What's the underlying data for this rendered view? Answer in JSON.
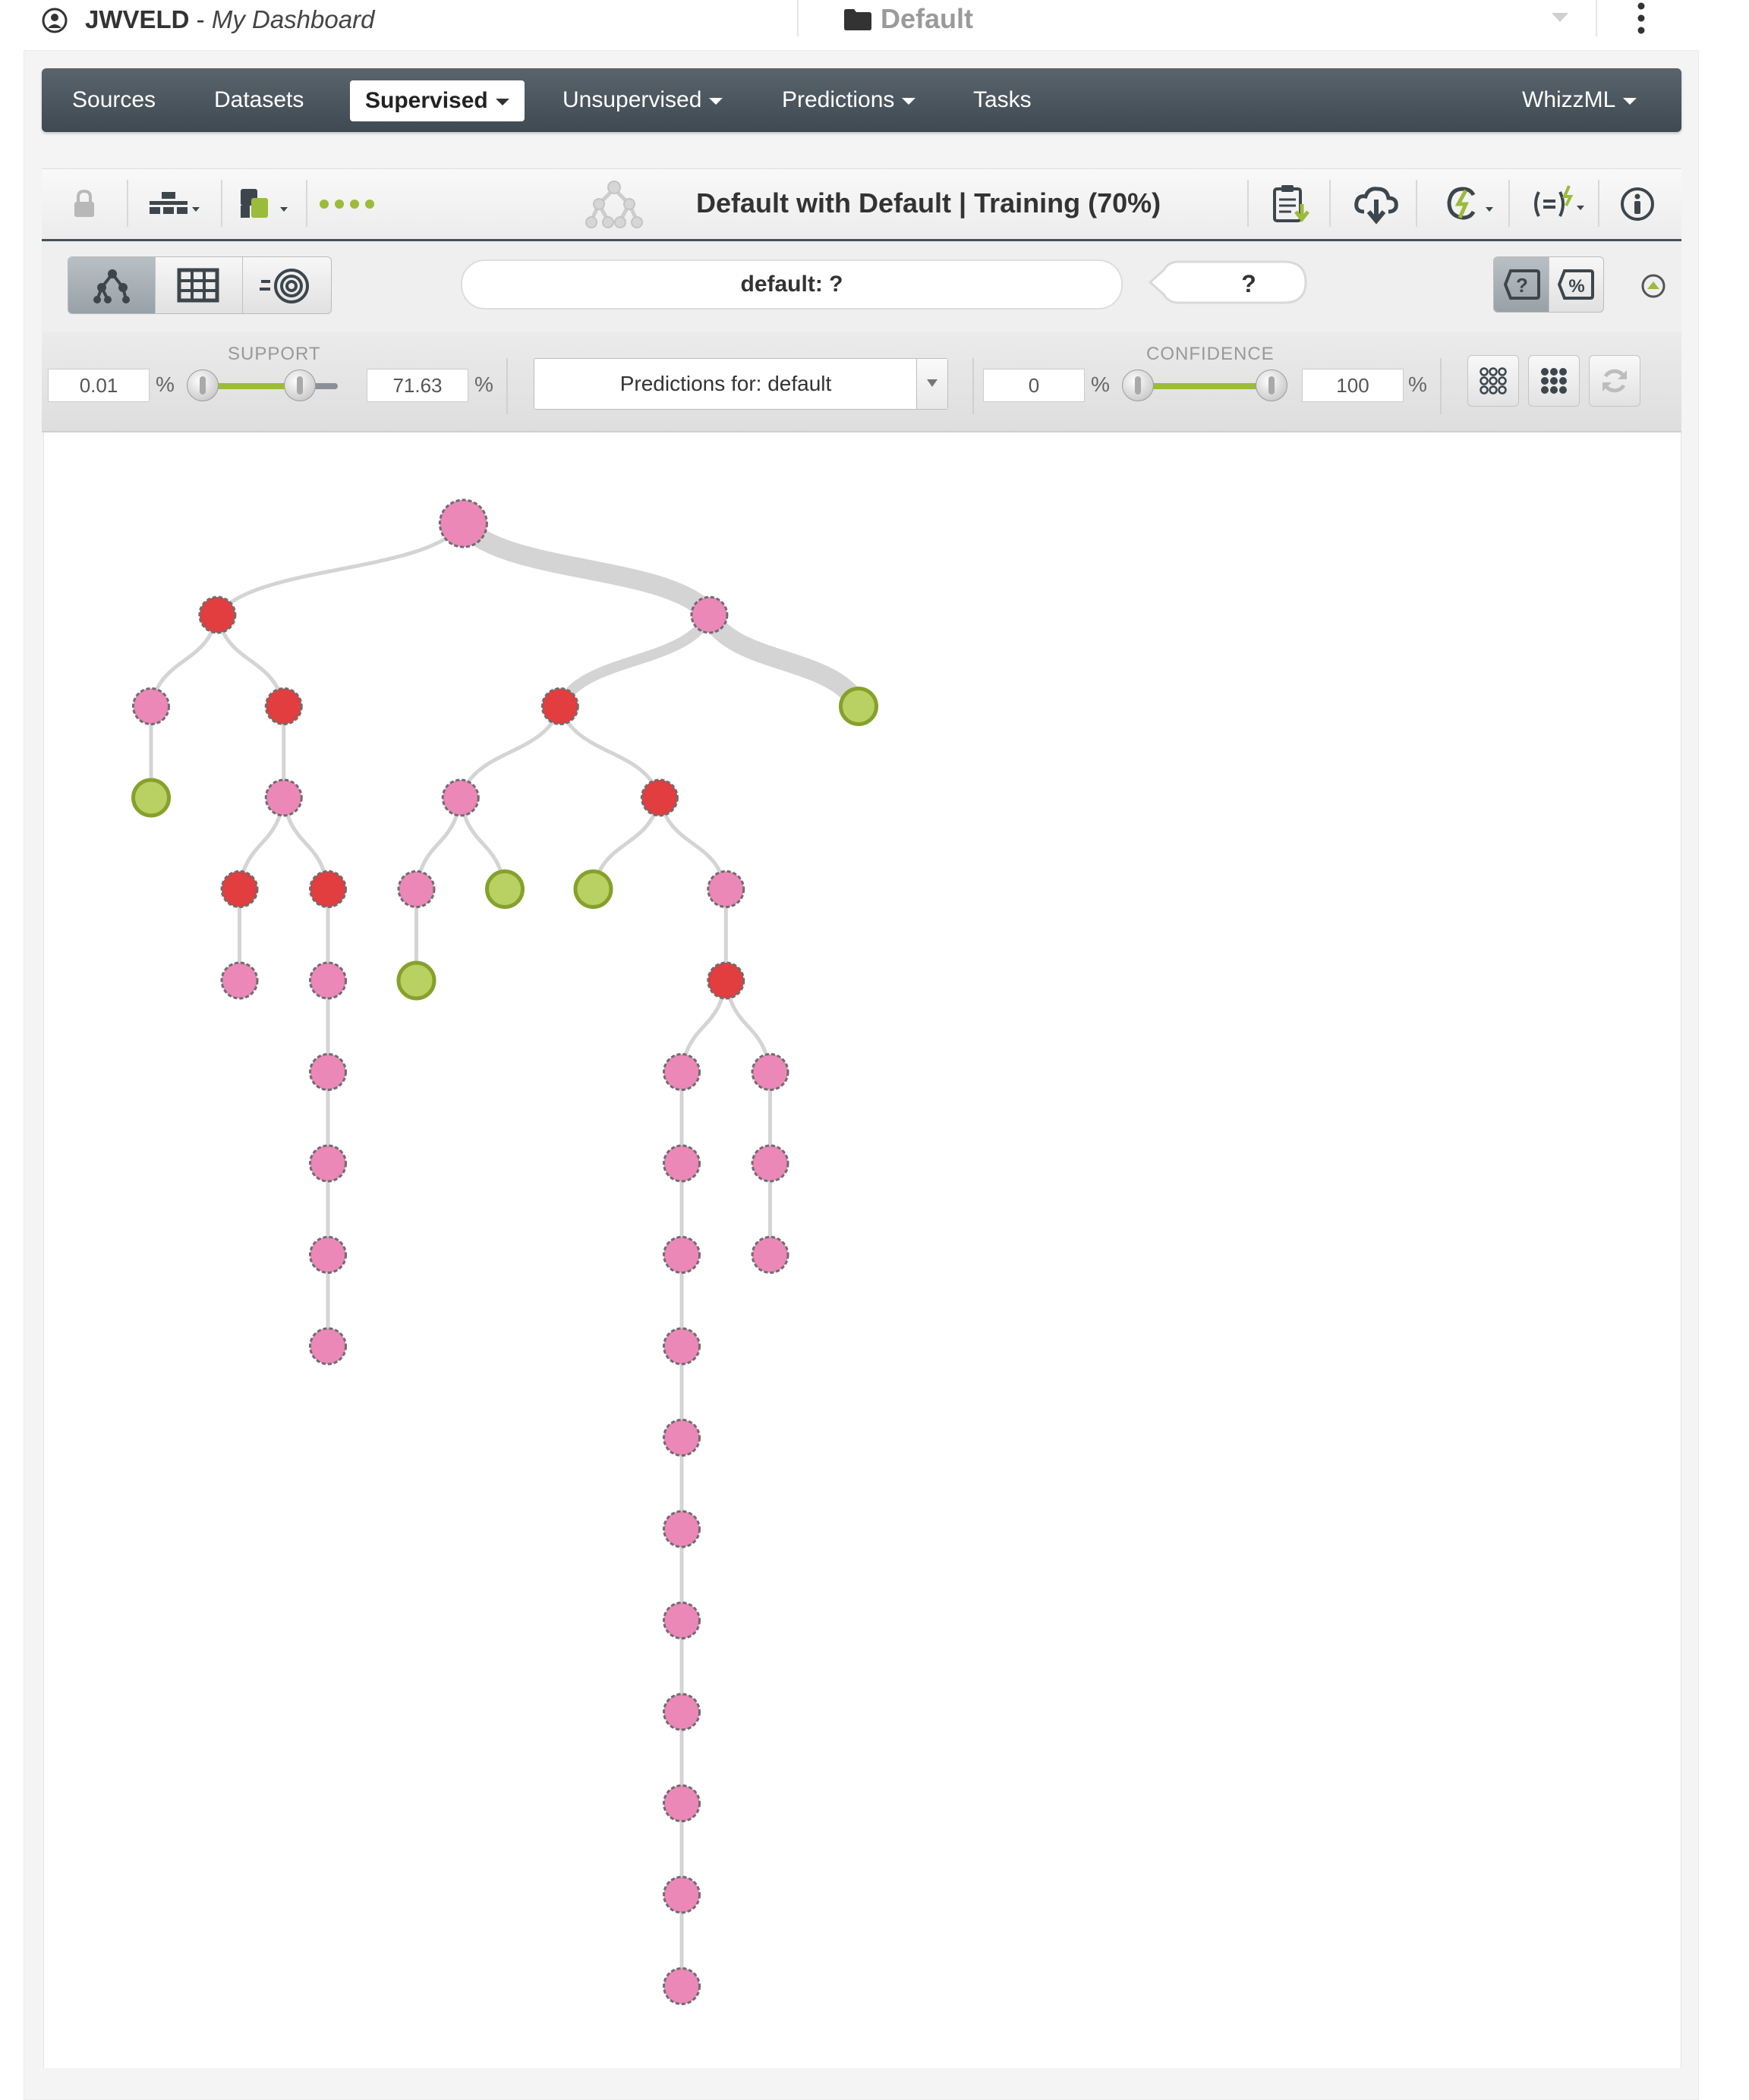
{
  "header": {
    "username": "JWVELD",
    "separator": " - ",
    "dashboard_label": "My Dashboard",
    "project_name": "Default"
  },
  "nav": {
    "items": [
      {
        "label": "Sources",
        "dropdown": false
      },
      {
        "label": "Datasets",
        "dropdown": false
      },
      {
        "label": "Supervised",
        "dropdown": true,
        "active": true
      },
      {
        "label": "Unsupervised",
        "dropdown": true
      },
      {
        "label": "Predictions",
        "dropdown": true
      },
      {
        "label": "Tasks",
        "dropdown": false
      }
    ],
    "right_item": {
      "label": "WhizzML",
      "dropdown": true
    }
  },
  "model": {
    "title": "Default with Default | Training (70%)"
  },
  "prediction": {
    "input_text": "default: ?",
    "result": "?"
  },
  "filters": {
    "support_label": "SUPPORT",
    "support_min": "0.01",
    "support_max": "71.63",
    "support_fill_fraction": [
      0.0,
      0.72
    ],
    "percent_symbol": "%",
    "predictions_for": "Predictions for: default",
    "confidence_label": "CONFIDENCE",
    "confidence_min": "0",
    "confidence_max": "100",
    "confidence_fill_fraction": [
      0.0,
      1.0
    ]
  },
  "tree": {
    "colors": {
      "pink": "#ec88b8",
      "red": "#e23d3f",
      "green": "#b9d062",
      "edge": "#d4d4d4",
      "accent": "#9cbb3a",
      "nav_dark": "#45505a"
    },
    "nodes": [
      {
        "id": "root",
        "parent": null,
        "type": "pink",
        "weight": "heavy"
      },
      {
        "id": "n1",
        "parent": "root",
        "type": "red"
      },
      {
        "id": "n2",
        "parent": "root",
        "type": "pink",
        "weight": "heavy"
      },
      {
        "id": "n3",
        "parent": "n1",
        "type": "pink"
      },
      {
        "id": "n4",
        "parent": "n1",
        "type": "red"
      },
      {
        "id": "n5",
        "parent": "n2",
        "type": "red",
        "weight": "medium"
      },
      {
        "id": "n6",
        "parent": "n2",
        "type": "green",
        "weight": "heavy"
      },
      {
        "id": "n7",
        "parent": "n3",
        "type": "green"
      },
      {
        "id": "n8",
        "parent": "n4",
        "type": "pink"
      },
      {
        "id": "n9",
        "parent": "n5",
        "type": "pink"
      },
      {
        "id": "n10",
        "parent": "n5",
        "type": "red"
      },
      {
        "id": "n11",
        "parent": "n8",
        "type": "red"
      },
      {
        "id": "n12",
        "parent": "n8",
        "type": "red"
      },
      {
        "id": "n13",
        "parent": "n9",
        "type": "pink"
      },
      {
        "id": "n14",
        "parent": "n9",
        "type": "green"
      },
      {
        "id": "n15",
        "parent": "n10",
        "type": "green"
      },
      {
        "id": "n16",
        "parent": "n10",
        "type": "pink"
      },
      {
        "id": "n17",
        "parent": "n11",
        "type": "pink"
      },
      {
        "id": "n18",
        "parent": "n12",
        "type": "pink"
      },
      {
        "id": "n19",
        "parent": "n13",
        "type": "green"
      },
      {
        "id": "n20",
        "parent": "n16",
        "type": "red"
      },
      {
        "id": "n21",
        "parent": "n18",
        "type": "pink"
      },
      {
        "id": "n22",
        "parent": "n20",
        "type": "pink"
      },
      {
        "id": "n23",
        "parent": "n20",
        "type": "pink"
      },
      {
        "id": "n24",
        "parent": "n21",
        "type": "pink"
      },
      {
        "id": "n25",
        "parent": "n22",
        "type": "pink"
      },
      {
        "id": "n26",
        "parent": "n23",
        "type": "pink"
      },
      {
        "id": "n27",
        "parent": "n24",
        "type": "pink"
      },
      {
        "id": "n28",
        "parent": "n25",
        "type": "pink"
      },
      {
        "id": "n29",
        "parent": "n26",
        "type": "pink"
      },
      {
        "id": "n30",
        "parent": "n27",
        "type": "pink"
      },
      {
        "id": "n31",
        "parent": "n28",
        "type": "pink"
      },
      {
        "id": "n32",
        "parent": "n31",
        "type": "pink"
      },
      {
        "id": "n33",
        "parent": "n32",
        "type": "pink"
      },
      {
        "id": "n34",
        "parent": "n33",
        "type": "pink"
      },
      {
        "id": "n35",
        "parent": "n34",
        "type": "pink"
      },
      {
        "id": "n36",
        "parent": "n35",
        "type": "pink"
      },
      {
        "id": "n37",
        "parent": "n36",
        "type": "pink"
      },
      {
        "id": "n38",
        "parent": "n37",
        "type": "pink"
      }
    ]
  }
}
